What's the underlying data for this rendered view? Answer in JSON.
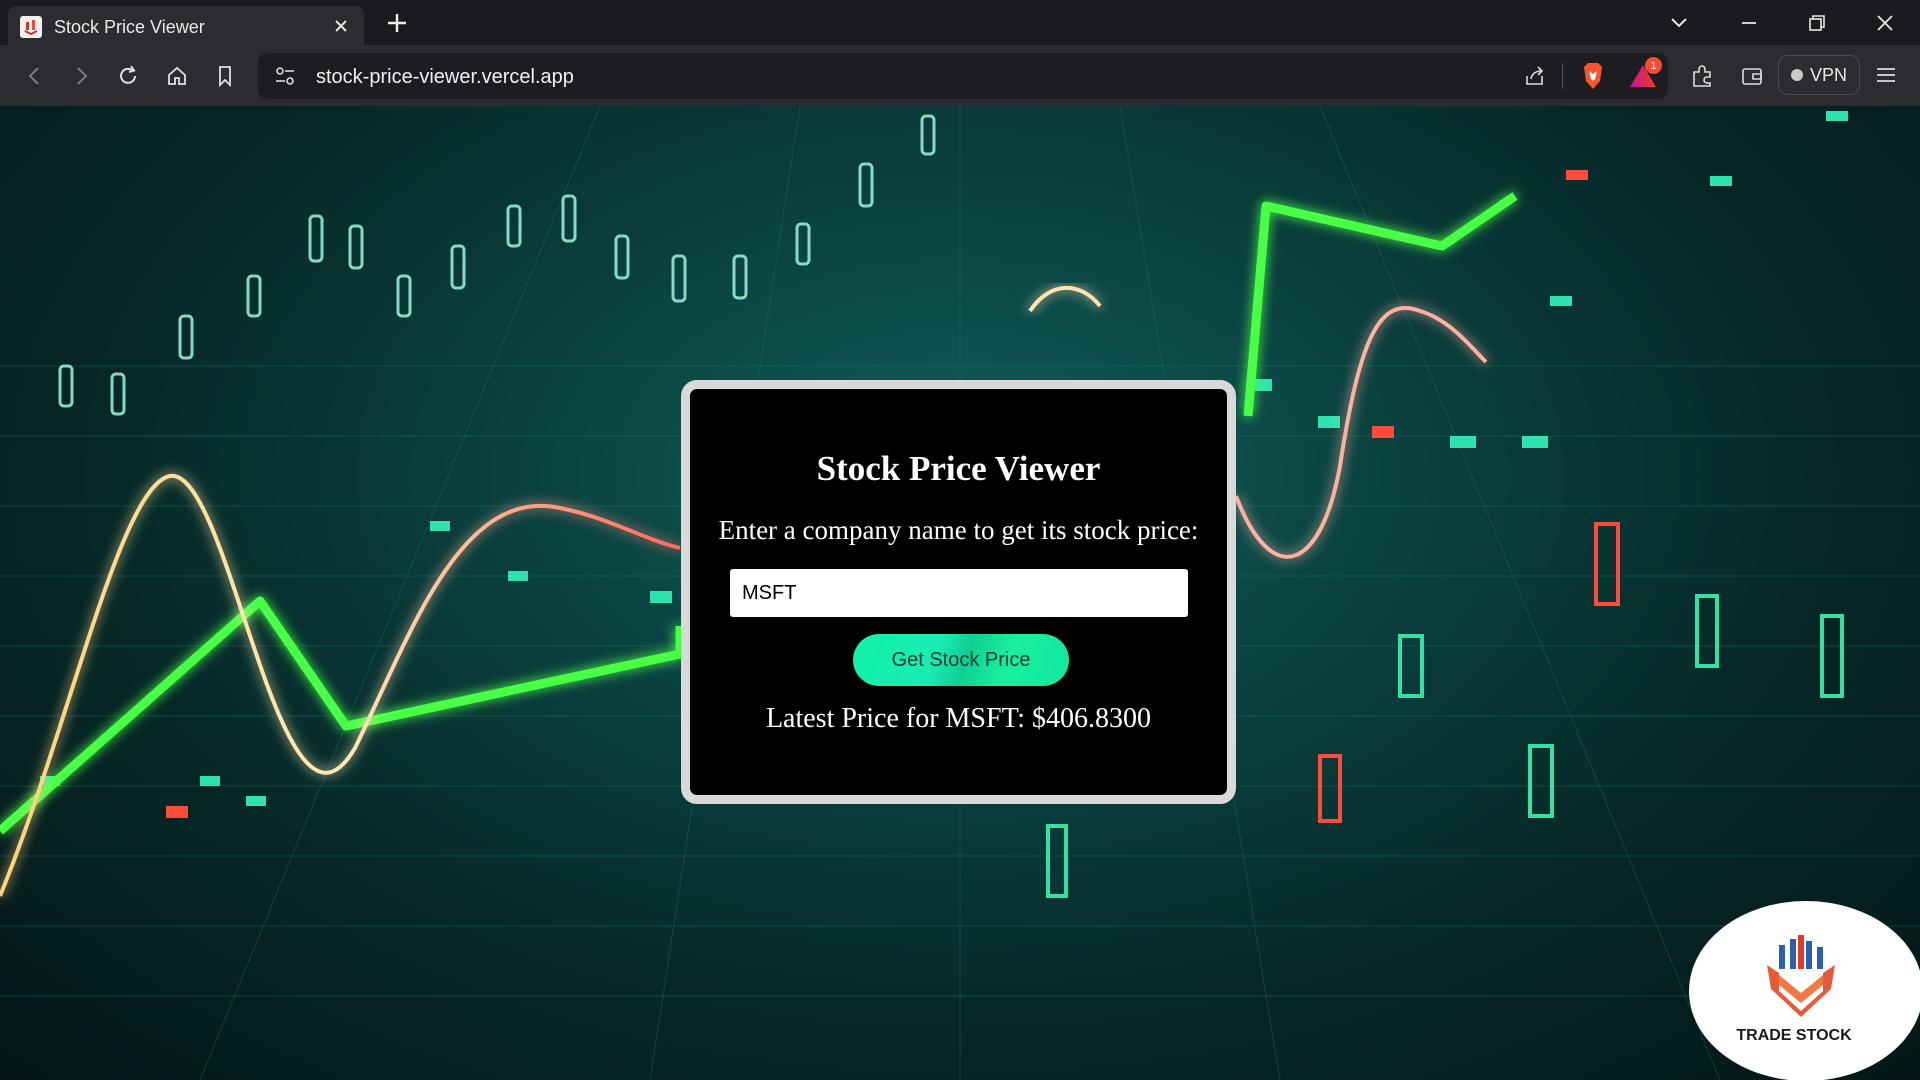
{
  "browser": {
    "tab_title": "Stock Price Viewer",
    "url": "stock-price-viewer.vercel.app",
    "vpn_label": "VPN",
    "notification_count": "1"
  },
  "app": {
    "title": "Stock Price Viewer",
    "subtitle": "Enter a company name to get its stock price:",
    "input_value": "MSFT",
    "button_label": "Get Stock Price",
    "result": "Latest Price for MSFT: $406.8300"
  },
  "logo": {
    "text": "TRADE STOCK"
  },
  "colors": {
    "accent": "#11f3a7",
    "card_border": "#d9d9d9",
    "card_background": "#000000"
  },
  "icons": [
    "tab-favicon",
    "close-icon",
    "plus-icon",
    "chevron-down-icon",
    "minimize-icon",
    "restore-icon",
    "close-window-icon",
    "back-icon",
    "forward-icon",
    "reload-icon",
    "home-icon",
    "bookmark-icon",
    "site-settings-icon",
    "share-icon",
    "brave-shield-icon",
    "rewards-icon",
    "extensions-icon",
    "wallet-icon",
    "menu-icon"
  ]
}
